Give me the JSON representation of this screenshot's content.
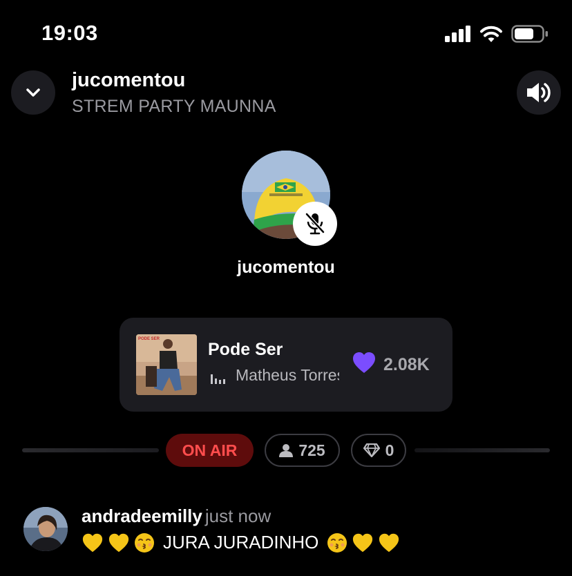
{
  "status_bar": {
    "time": "19:03"
  },
  "header": {
    "title": "jucomentou",
    "subtitle": "STREM PARTY MAUNNA"
  },
  "host": {
    "name": "jucomentou",
    "muted": true
  },
  "now_playing": {
    "title": "Pode Ser",
    "artist": "Matheus Torres",
    "likes": "2.08K",
    "album_text": "PODE SER"
  },
  "stats": {
    "status": "ON AIR",
    "viewers": "725",
    "gems": "0"
  },
  "comment": {
    "username": "andradeemilly",
    "time": "just now",
    "text": "JURA JURADINHO",
    "emoji_before": [
      "yellow-heart",
      "yellow-heart",
      "kissing-face"
    ],
    "emoji_after": [
      "kissing-face",
      "yellow-heart",
      "yellow-heart"
    ]
  },
  "colors": {
    "background": "#000000",
    "card": "#1c1c21",
    "on_air_bg": "#5e0c0c",
    "on_air_text": "#ff4d4d",
    "heart": "#7b4dff",
    "gold": "#f5c518"
  }
}
